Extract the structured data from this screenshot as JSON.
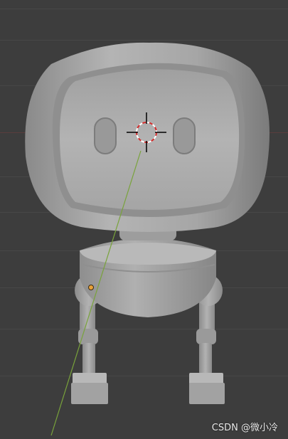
{
  "viewport": {
    "background_color": "#3d3d3d",
    "grid_line_color": "#474747",
    "x_axis_color": "#5a3d3d"
  },
  "scene": {
    "object": "cartoon-robot-mesh",
    "mesh_color": "#a9a9a9",
    "origin_point_color": "#e8a23a",
    "normal_line_color": "#79a33b",
    "cursor_ring_colors": [
      "#ffffff",
      "#d12b2b"
    ]
  },
  "watermark": {
    "text": "CSDN @微小冷"
  }
}
